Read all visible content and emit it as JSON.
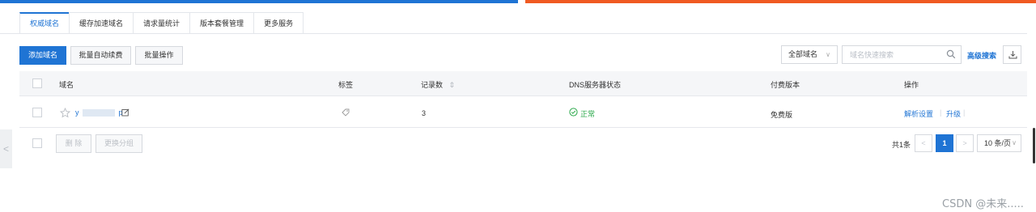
{
  "tabs": [
    {
      "label": "权威域名",
      "active": true
    },
    {
      "label": "缓存加速域名",
      "active": false
    },
    {
      "label": "请求量统计",
      "active": false
    },
    {
      "label": "版本套餐管理",
      "active": false
    },
    {
      "label": "更多服务",
      "active": false
    }
  ],
  "toolbar": {
    "add_domain": "添加域名",
    "batch_renew": "批量自动续费",
    "batch_ops": "批量操作",
    "domain_filter": "全部域名",
    "search_placeholder": "域名快速搜索",
    "advanced_search": "高级搜索"
  },
  "table": {
    "headers": {
      "domain": "域名",
      "tags": "标签",
      "records": "记录数",
      "records_sort": "⇕",
      "dns_status": "DNS服务器状态",
      "plan": "付费版本",
      "actions": "操作"
    },
    "rows": [
      {
        "domain_prefix": "y",
        "domain_suffix": "p",
        "records": "3",
        "dns_status": "正常",
        "plan": "免费版",
        "action_resolve": "解析设置",
        "action_upgrade": "升级",
        "action_sep": "|"
      }
    ]
  },
  "footer": {
    "delete": "删 除",
    "change_group": "更换分组",
    "total": "共1条",
    "prev": "<",
    "page": "1",
    "next": ">",
    "page_size": "10 条/页"
  },
  "side": {
    "left_arrow": "<"
  },
  "watermark": "CSDN @未来.....",
  "colors": {
    "primary": "#1f74d4",
    "accent": "#f05a22",
    "success": "#2aa84a"
  },
  "icons": [
    "star-icon",
    "edit-icon",
    "tag-icon",
    "check-circle-icon",
    "search-icon",
    "download-icon",
    "chevron-down-icon"
  ]
}
